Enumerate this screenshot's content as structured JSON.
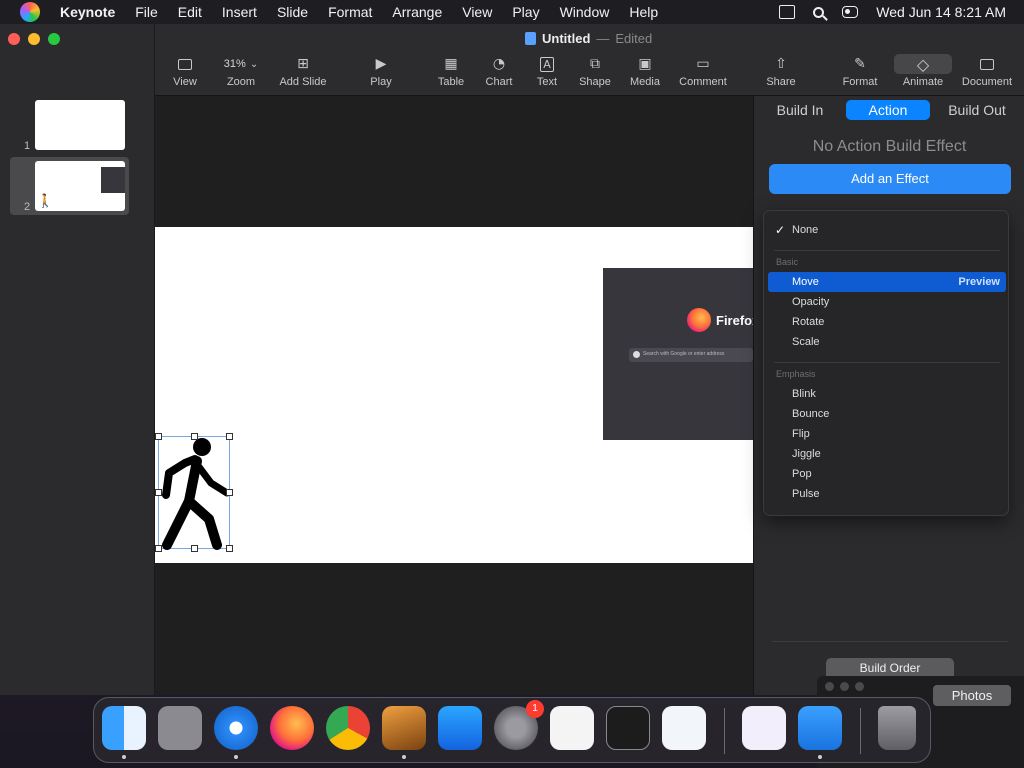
{
  "menubar": {
    "app_name": "Keynote",
    "items": [
      "File",
      "Edit",
      "Insert",
      "Slide",
      "Format",
      "Arrange",
      "View",
      "Play",
      "Window",
      "Help"
    ],
    "clock": "Wed Jun 14  8:21 AM",
    "status_icons": [
      "screen-mirroring-icon",
      "search-icon",
      "control-center-icon"
    ]
  },
  "window": {
    "title": "Untitled",
    "title_separator": "—",
    "title_state": "Edited"
  },
  "toolbar": {
    "zoom_value": "31%",
    "tools": [
      {
        "label": "View",
        "icon": "sidebar-icon"
      },
      {
        "label": "Zoom",
        "icon": "zoom-icon"
      },
      {
        "label": "Add Slide",
        "icon": "add-slide-icon"
      },
      {
        "label": "Play",
        "icon": "play-icon"
      },
      {
        "label": "Table",
        "icon": "table-icon"
      },
      {
        "label": "Chart",
        "icon": "chart-icon"
      },
      {
        "label": "Text",
        "icon": "text-icon"
      },
      {
        "label": "Shape",
        "icon": "shape-icon"
      },
      {
        "label": "Media",
        "icon": "media-icon"
      },
      {
        "label": "Comment",
        "icon": "comment-icon"
      },
      {
        "label": "Share",
        "icon": "share-icon"
      },
      {
        "label": "Format",
        "icon": "format-brush-icon"
      },
      {
        "label": "Animate",
        "icon": "animate-diamond-icon"
      },
      {
        "label": "Document",
        "icon": "document-icon"
      }
    ],
    "active_tool": "Animate"
  },
  "sidebar": {
    "slides": [
      {
        "number": "1",
        "selected": false
      },
      {
        "number": "2",
        "selected": true
      }
    ]
  },
  "slide": {
    "screenshot_brand": "Firefox",
    "screenshot_search": "Search with Google or enter address"
  },
  "inspector": {
    "tabs": [
      "Build In",
      "Action",
      "Build Out"
    ],
    "active_tab": "Action",
    "status": "No Action Build Effect",
    "add_effect_button": "Add an Effect",
    "build_order_button": "Build Order"
  },
  "effect_menu": {
    "none_label": "None",
    "basic_header": "Basic",
    "basic_items": [
      "Move",
      "Opacity",
      "Rotate",
      "Scale"
    ],
    "emphasis_header": "Emphasis",
    "emphasis_items": [
      "Blink",
      "Bounce",
      "Flip",
      "Jiggle",
      "Pop",
      "Pulse"
    ],
    "highlighted": "Move",
    "preview_label": "Preview"
  },
  "photos": {
    "label": "Photos"
  },
  "dock": {
    "apps": [
      "Finder",
      "Launchpad",
      "Safari",
      "Firefox",
      "Chrome",
      "GarageBand",
      "App Store",
      "System Settings",
      "TextEdit",
      "Terminal",
      "Visual Studio Code",
      "Visual Studio",
      "Keynote",
      "Trash"
    ],
    "settings_badge": "1"
  },
  "colors": {
    "accent": "#0a84ff",
    "add_effect": "#2b8af5",
    "menu_highlight": "#0f5bd1"
  }
}
